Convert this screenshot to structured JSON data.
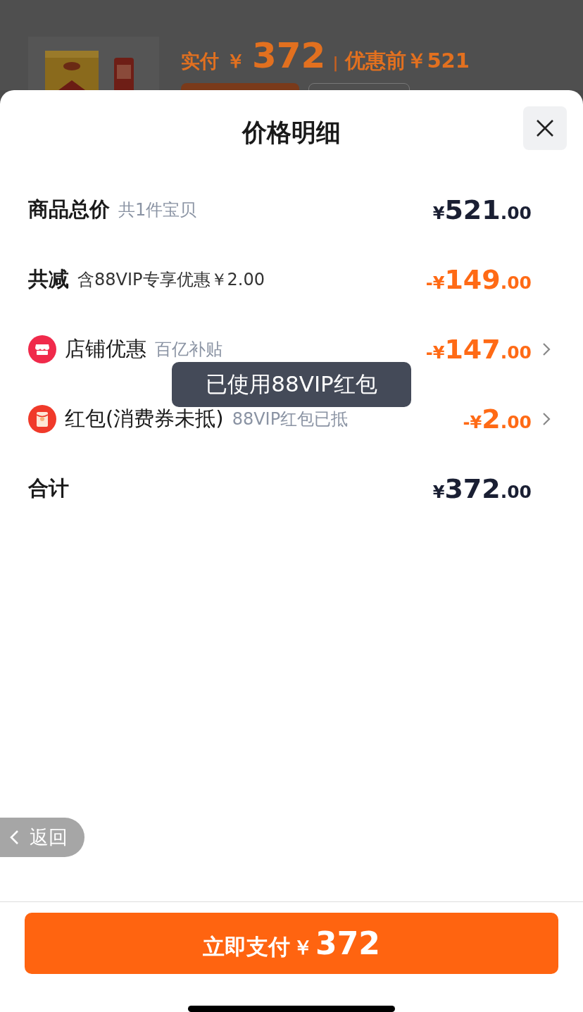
{
  "background": {
    "paid_label": "实付",
    "paid_currency": "￥",
    "paid_amount": "372",
    "separator": "|",
    "before_label": "优惠前￥521"
  },
  "sheet": {
    "title": "价格明细",
    "rows": [
      {
        "kind": "total",
        "label": "商品总价",
        "note": "共1件宝贝",
        "amount": {
          "prefix": "¥",
          "integer": "521",
          "decimal": ".00"
        },
        "highlight": false,
        "chevron": false
      },
      {
        "kind": "discount",
        "label": "共减",
        "note": "含88VIP专享优惠￥2.00",
        "amount": {
          "prefix": "-¥",
          "integer": "149",
          "decimal": ".00"
        },
        "highlight": true,
        "chevron": false
      },
      {
        "kind": "store",
        "label": "店铺优惠",
        "note": "百亿补贴",
        "amount": {
          "prefix": "-¥",
          "integer": "147",
          "decimal": ".00"
        },
        "highlight": true,
        "chevron": true
      },
      {
        "kind": "packet",
        "label": "红包(消费券未抵)",
        "note": "88VIP红包已抵",
        "amount": {
          "prefix": "-¥",
          "integer": "2",
          "decimal": ".00"
        },
        "highlight": true,
        "chevron": true
      },
      {
        "kind": "sum",
        "label": "合计",
        "amount": {
          "prefix": "¥",
          "integer": "372",
          "decimal": ".00"
        },
        "highlight": false,
        "chevron": false
      }
    ],
    "toast": "已使用88VIP红包",
    "back_button": "返回",
    "pay_button": {
      "label": "立即支付",
      "currency": "￥",
      "amount": "372"
    }
  }
}
